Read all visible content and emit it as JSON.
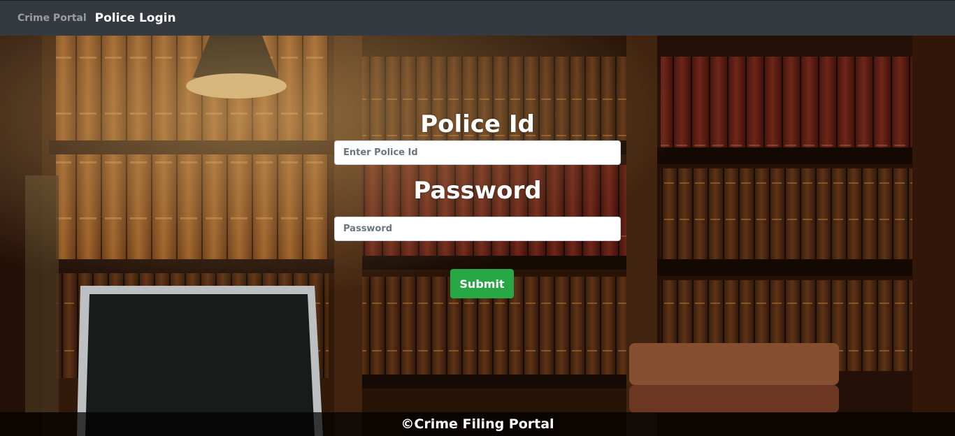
{
  "navbar": {
    "brand": "Crime Portal",
    "active_link": "Police Login"
  },
  "form": {
    "police_id_label": "Police Id",
    "police_id_placeholder": "Enter Police Id",
    "police_id_value": "",
    "password_label": "Password",
    "password_placeholder": "Password",
    "password_value": "",
    "submit_label": "Submit"
  },
  "footer": {
    "text": "©Crime Filing Portal"
  },
  "colors": {
    "navbar_bg": "#343a40",
    "submit_bg": "#28a745",
    "label_text": "#ffffff"
  },
  "background": {
    "image": "library-bookshelves-photo"
  }
}
